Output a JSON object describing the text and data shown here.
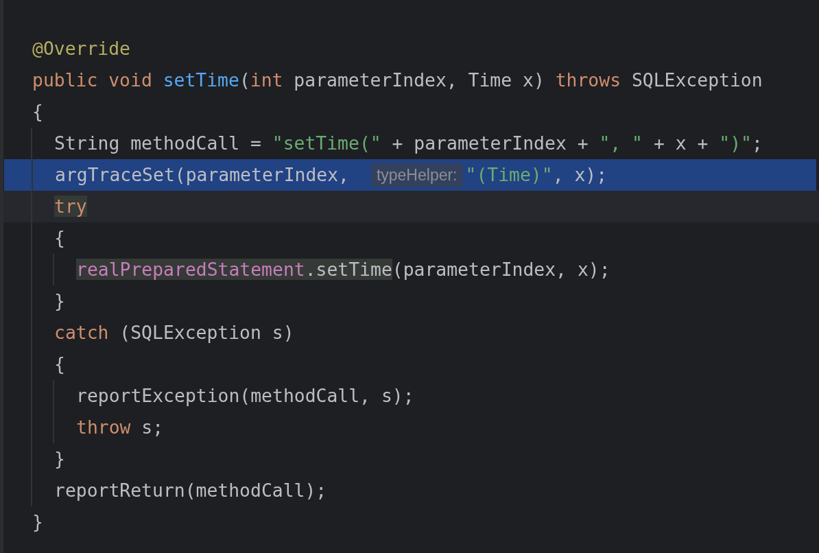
{
  "lines": [
    {
      "selected": false,
      "current": false,
      "tokens": [
        {
          "text": "@Override",
          "kind": "annotation",
          "highlighted": false
        }
      ]
    },
    {
      "selected": false,
      "current": false,
      "tokens": [
        {
          "text": "public void ",
          "kind": "keyword",
          "highlighted": false
        },
        {
          "text": "setTime",
          "kind": "declaration",
          "highlighted": false
        },
        {
          "text": "(",
          "kind": "plain",
          "highlighted": false
        },
        {
          "text": "int ",
          "kind": "keyword",
          "highlighted": false
        },
        {
          "text": "parameterIndex, Time x) ",
          "kind": "plain",
          "highlighted": false
        },
        {
          "text": "throws ",
          "kind": "keyword",
          "highlighted": false
        },
        {
          "text": "SQLException",
          "kind": "plain",
          "highlighted": false
        }
      ]
    },
    {
      "selected": false,
      "current": false,
      "tokens": [
        {
          "text": "{",
          "kind": "plain",
          "highlighted": false
        }
      ],
      "children": [
        {
          "selected": false,
          "current": false,
          "tokens": [
            {
              "text": "String methodCall = ",
              "kind": "plain",
              "highlighted": false
            },
            {
              "text": "\"setTime(\"",
              "kind": "string",
              "highlighted": false
            },
            {
              "text": " + parameterIndex + ",
              "kind": "plain",
              "highlighted": false
            },
            {
              "text": "\", \"",
              "kind": "string",
              "highlighted": false
            },
            {
              "text": " + x + ",
              "kind": "plain",
              "highlighted": false
            },
            {
              "text": "\")\"",
              "kind": "string",
              "highlighted": false
            },
            {
              "text": ";",
              "kind": "plain",
              "highlighted": false
            }
          ]
        },
        {
          "selected": true,
          "current": false,
          "tokens": [
            {
              "text": "argTraceSet(parameterIndex, ",
              "kind": "plain",
              "highlighted": false
            },
            {
              "text": "typeHelper:",
              "kind": "hint",
              "highlighted": false
            },
            {
              "text": "\"(Time)\"",
              "kind": "string",
              "highlighted": false
            },
            {
              "text": ", x);",
              "kind": "plain",
              "highlighted": false
            }
          ]
        },
        {
          "selected": false,
          "current": true,
          "tokens": [
            {
              "text": "try",
              "kind": "keyword",
              "highlighted": true
            }
          ]
        },
        {
          "selected": false,
          "current": false,
          "tokens": [
            {
              "text": "{",
              "kind": "plain",
              "highlighted": false
            }
          ],
          "children": [
            {
              "selected": false,
              "current": false,
              "tokens": [
                {
                  "text": "realPreparedStatement",
                  "kind": "field",
                  "highlighted": true
                },
                {
                  "text": ".setTime",
                  "kind": "plain",
                  "highlighted": true
                },
                {
                  "text": "(parameterIndex, x);",
                  "kind": "plain",
                  "highlighted": false
                }
              ]
            }
          ]
        },
        {
          "selected": false,
          "current": false,
          "tokens": [
            {
              "text": "}",
              "kind": "plain",
              "highlighted": false
            }
          ]
        },
        {
          "selected": false,
          "current": false,
          "tokens": [
            {
              "text": "catch ",
              "kind": "keyword",
              "highlighted": false
            },
            {
              "text": "(SQLException s)",
              "kind": "plain",
              "highlighted": false
            }
          ]
        },
        {
          "selected": false,
          "current": false,
          "tokens": [
            {
              "text": "{",
              "kind": "plain",
              "highlighted": false
            }
          ],
          "children": [
            {
              "selected": false,
              "current": false,
              "tokens": [
                {
                  "text": "reportException(methodCall, s);",
                  "kind": "plain",
                  "highlighted": false
                }
              ]
            },
            {
              "selected": false,
              "current": false,
              "tokens": [
                {
                  "text": "throw ",
                  "kind": "keyword",
                  "highlighted": false
                },
                {
                  "text": "s;",
                  "kind": "plain",
                  "highlighted": false
                }
              ]
            }
          ]
        },
        {
          "selected": false,
          "current": false,
          "tokens": [
            {
              "text": "}",
              "kind": "plain",
              "highlighted": false
            }
          ]
        },
        {
          "selected": false,
          "current": false,
          "tokens": [
            {
              "text": "reportReturn(methodCall);",
              "kind": "plain",
              "highlighted": false
            }
          ]
        }
      ]
    },
    {
      "selected": false,
      "current": false,
      "tokens": [
        {
          "text": "}",
          "kind": "plain",
          "highlighted": false
        }
      ]
    }
  ]
}
